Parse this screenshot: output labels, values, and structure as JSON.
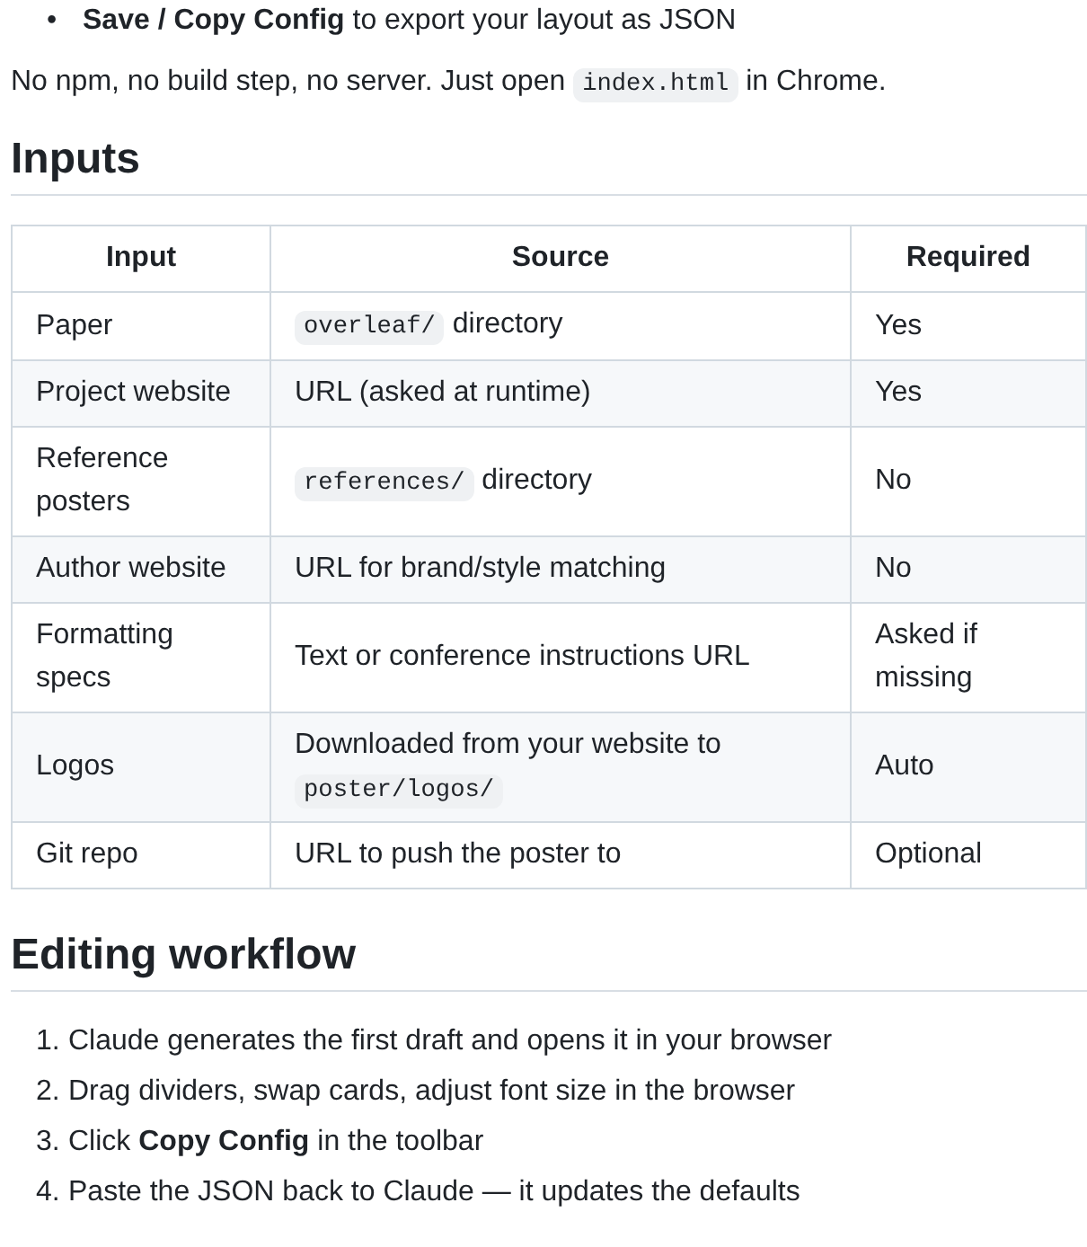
{
  "top_bullet": {
    "marker": "•",
    "text": "**Save / Copy Config** to export your layout as JSON"
  },
  "intro": [
    {
      "kind": "text",
      "text": "No npm, no build step, no server. Just open "
    },
    {
      "kind": "code",
      "text": "index.html"
    },
    {
      "kind": "text",
      "text": " in Chrome."
    }
  ],
  "inputs_heading": "Inputs",
  "table": {
    "columns": [
      "Input",
      "Source",
      "Required"
    ],
    "rows": [
      {
        "input": "Paper",
        "source": [
          {
            "kind": "code",
            "text": "overleaf/"
          },
          {
            "kind": "text",
            "text": " directory"
          }
        ],
        "required": "Yes"
      },
      {
        "input": "Project website",
        "source": [
          {
            "kind": "text",
            "text": "URL (asked at runtime)"
          }
        ],
        "required": "Yes"
      },
      {
        "input": "Reference posters",
        "source": [
          {
            "kind": "code",
            "text": "references/"
          },
          {
            "kind": "text",
            "text": " directory"
          }
        ],
        "required": "No"
      },
      {
        "input": "Author website",
        "source": [
          {
            "kind": "text",
            "text": "URL for brand/style matching"
          }
        ],
        "required": "No"
      },
      {
        "input": "Formatting specs",
        "source": [
          {
            "kind": "text",
            "text": "Text or conference instructions URL"
          }
        ],
        "required": "Asked if missing"
      },
      {
        "input": "Logos",
        "source": [
          {
            "kind": "text",
            "text": "Downloaded from your website to "
          },
          {
            "kind": "code",
            "text": "poster/logos/"
          }
        ],
        "required": "Auto"
      },
      {
        "input": "Git repo",
        "source": [
          {
            "kind": "text",
            "text": "URL to push the poster to"
          }
        ],
        "required": "Optional"
      }
    ]
  },
  "workflow_heading": "Editing workflow",
  "workflow_steps": [
    {
      "marker": "1.",
      "text": "Claude generates the first draft and opens it in your browser"
    },
    {
      "marker": "2.",
      "text": "Drag dividers, swap cards, adjust font size in the browser"
    },
    {
      "marker": "3.",
      "text": "Click **Copy Config** in the toolbar"
    },
    {
      "marker": "4.",
      "text": "Paste the JSON back to Claude — it updates the defaults"
    }
  ]
}
